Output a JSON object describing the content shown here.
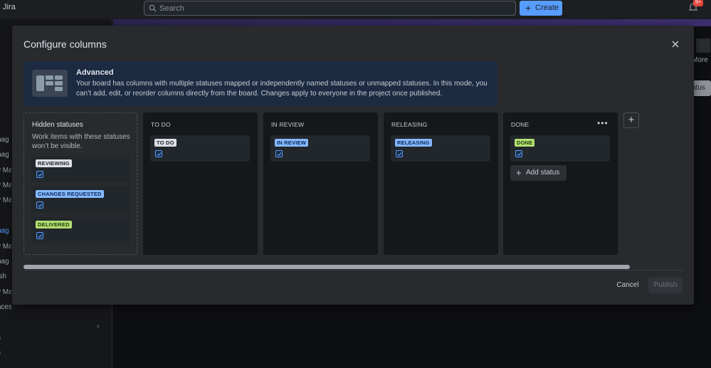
{
  "app": {
    "name": "Jira"
  },
  "topbar": {
    "search_placeholder": "Search",
    "create_label": "Create",
    "notification_badge": "9+"
  },
  "sidebar": {
    "items": [
      "nag",
      "nag",
      "y Ma",
      "y Ma",
      "y Ma",
      "nag",
      "y Ma",
      "nag",
      "ish",
      "y Ma",
      "aces",
      "s",
      "s"
    ]
  },
  "behind": {
    "more_label": "More",
    "status_btn_label": "atus"
  },
  "modal": {
    "title": "Configure columns",
    "info": {
      "title": "Advanced",
      "text": "Your board has columns with multiple statuses mapped or independently named statuses or unmapped statuses. In this mode, you can’t add, edit, or reorder columns directly from the board. Changes apply to everyone in the project once published."
    },
    "hidden": {
      "title": "Hidden statuses",
      "description": "Work items with these statuses won’t be visible.",
      "statuses": [
        {
          "label": "REVIEWING",
          "color": "grey"
        },
        {
          "label": "CHANGES REQUESTED",
          "color": "blue"
        },
        {
          "label": "DELIVERED",
          "color": "green"
        }
      ]
    },
    "columns": [
      {
        "title": "TO DO",
        "status": {
          "label": "TO DO",
          "color": "grey"
        }
      },
      {
        "title": "IN REVIEW",
        "status": {
          "label": "IN REVIEW",
          "color": "blue"
        }
      },
      {
        "title": "RELEASING",
        "status": {
          "label": "RELEASING",
          "color": "blue"
        }
      },
      {
        "title": "DONE",
        "status": {
          "label": "DONE",
          "color": "green"
        },
        "add_status_label": "Add status"
      }
    ],
    "cancel_label": "Cancel",
    "publish_label": "Publish"
  },
  "colors": {
    "accent": "#579dff",
    "modal_bg": "#282a2e",
    "info_bg": "#1c2b41"
  },
  "icons": [
    "search-icon",
    "plus-icon",
    "bell-icon",
    "close-icon",
    "board-icon",
    "checkbox-checked-icon",
    "more-horizontal-icon",
    "share-icon",
    "chevron-right-icon"
  ]
}
